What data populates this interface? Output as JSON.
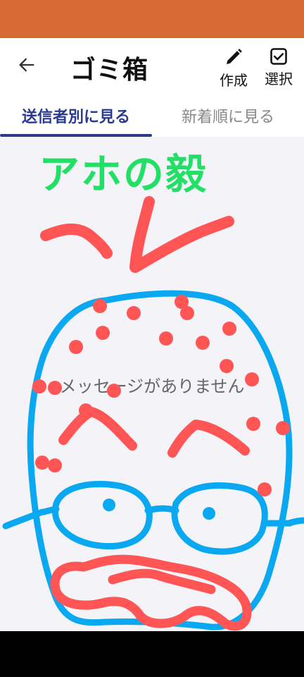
{
  "app_bar": {
    "title": "ゴミ箱",
    "create_label": "作成",
    "select_label": "選択"
  },
  "tabs": [
    {
      "label": "送信者別に見る",
      "active": true
    },
    {
      "label": "新着順に見る",
      "active": false
    }
  ],
  "empty_message": "メッセージがありません",
  "doodle": {
    "text": "アホの毅",
    "text_color": "#22e066",
    "face_color": "#0aa8f0",
    "marks_color": "#ff5555"
  },
  "colors": {
    "status_bar": "#d66a33",
    "accent": "#2b3a8f",
    "content_bg": "#f3f3f8"
  }
}
